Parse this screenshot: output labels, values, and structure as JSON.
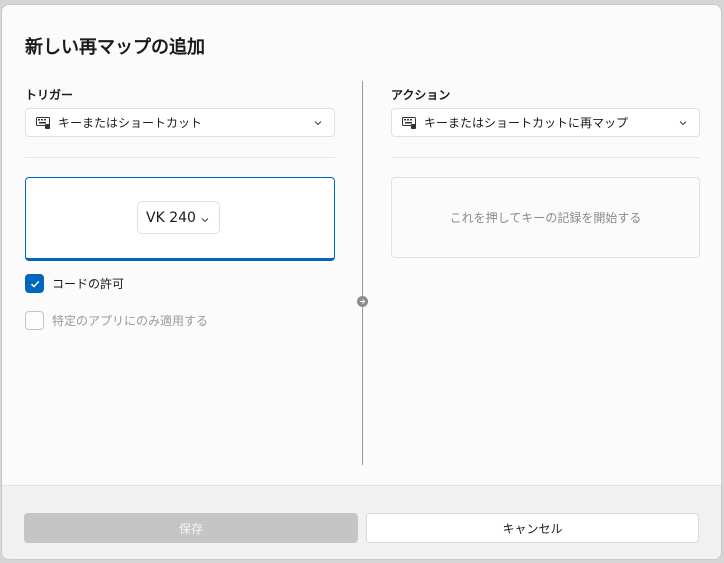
{
  "dialog": {
    "title": "新しい再マップの追加"
  },
  "trigger": {
    "label": "トリガー",
    "type_selected": "キーまたはショートカット",
    "key_value": "VK 240",
    "allow_chord_label": "コードの許可",
    "allow_chord_checked": true,
    "app_specific_label": "特定のアプリにのみ適用する",
    "app_specific_checked": false
  },
  "action": {
    "label": "アクション",
    "type_selected": "キーまたはショートカットに再マップ",
    "record_prompt": "これを押してキーの記録を開始する"
  },
  "footer": {
    "save_label": "保存",
    "cancel_label": "キャンセル"
  },
  "colors": {
    "accent": "#0067c0",
    "disabled_button": "#c5c5c5"
  },
  "icons": {
    "type_icon": "keyboard-icon",
    "dropdown": "chevron-down-icon",
    "separator": "arrow-right-circle-icon",
    "check": "checkmark-icon"
  }
}
